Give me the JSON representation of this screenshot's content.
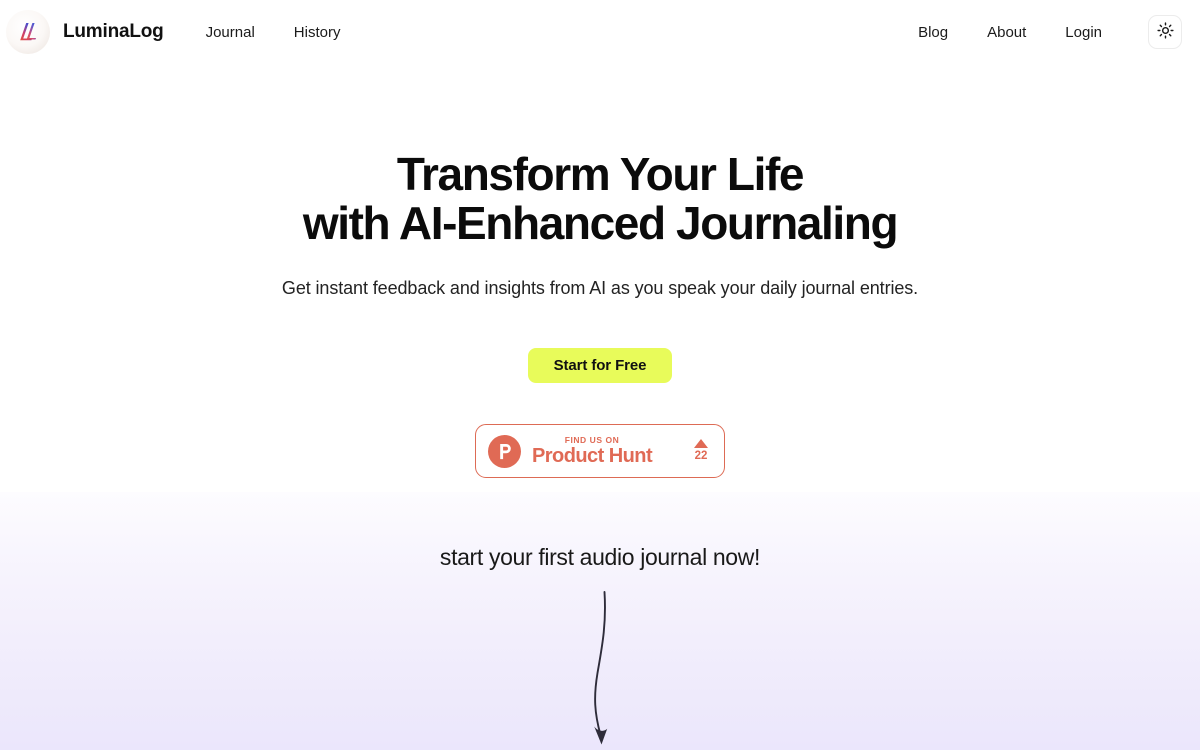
{
  "header": {
    "brand": {
      "name": "LuminaLog",
      "logo_icon": "luminalog-logo-icon"
    },
    "nav_primary": [
      {
        "label": "Journal"
      },
      {
        "label": "History"
      }
    ],
    "nav_right": [
      {
        "label": "Blog"
      },
      {
        "label": "About"
      },
      {
        "label": "Login"
      }
    ],
    "theme_toggle": {
      "icon": "sun-icon",
      "aria_label": "Toggle theme"
    }
  },
  "hero": {
    "title_line_1": "Transform Your Life",
    "title_line_2": "with AI-Enhanced Journaling",
    "subtitle": "Get instant feedback and insights from AI as you speak your daily journal entries.",
    "cta_label": "Start for Free"
  },
  "product_hunt": {
    "kicker": "FIND US ON",
    "name": "Product Hunt",
    "vote_count": "22",
    "logo_letter": "P",
    "upvote_icon": "triangle-up-icon"
  },
  "audio_section": {
    "heading": "start your first audio journal now!",
    "arrow_icon": "curved-arrow-down-icon"
  },
  "colors": {
    "cta_yellow": "#E8FB5A",
    "product_hunt_coral": "#E06A55",
    "text_primary": "#111111",
    "page_background": "#FFFFFF",
    "gradient_top": "#FDFCFF",
    "gradient_bottom": "#EBE6FC"
  }
}
